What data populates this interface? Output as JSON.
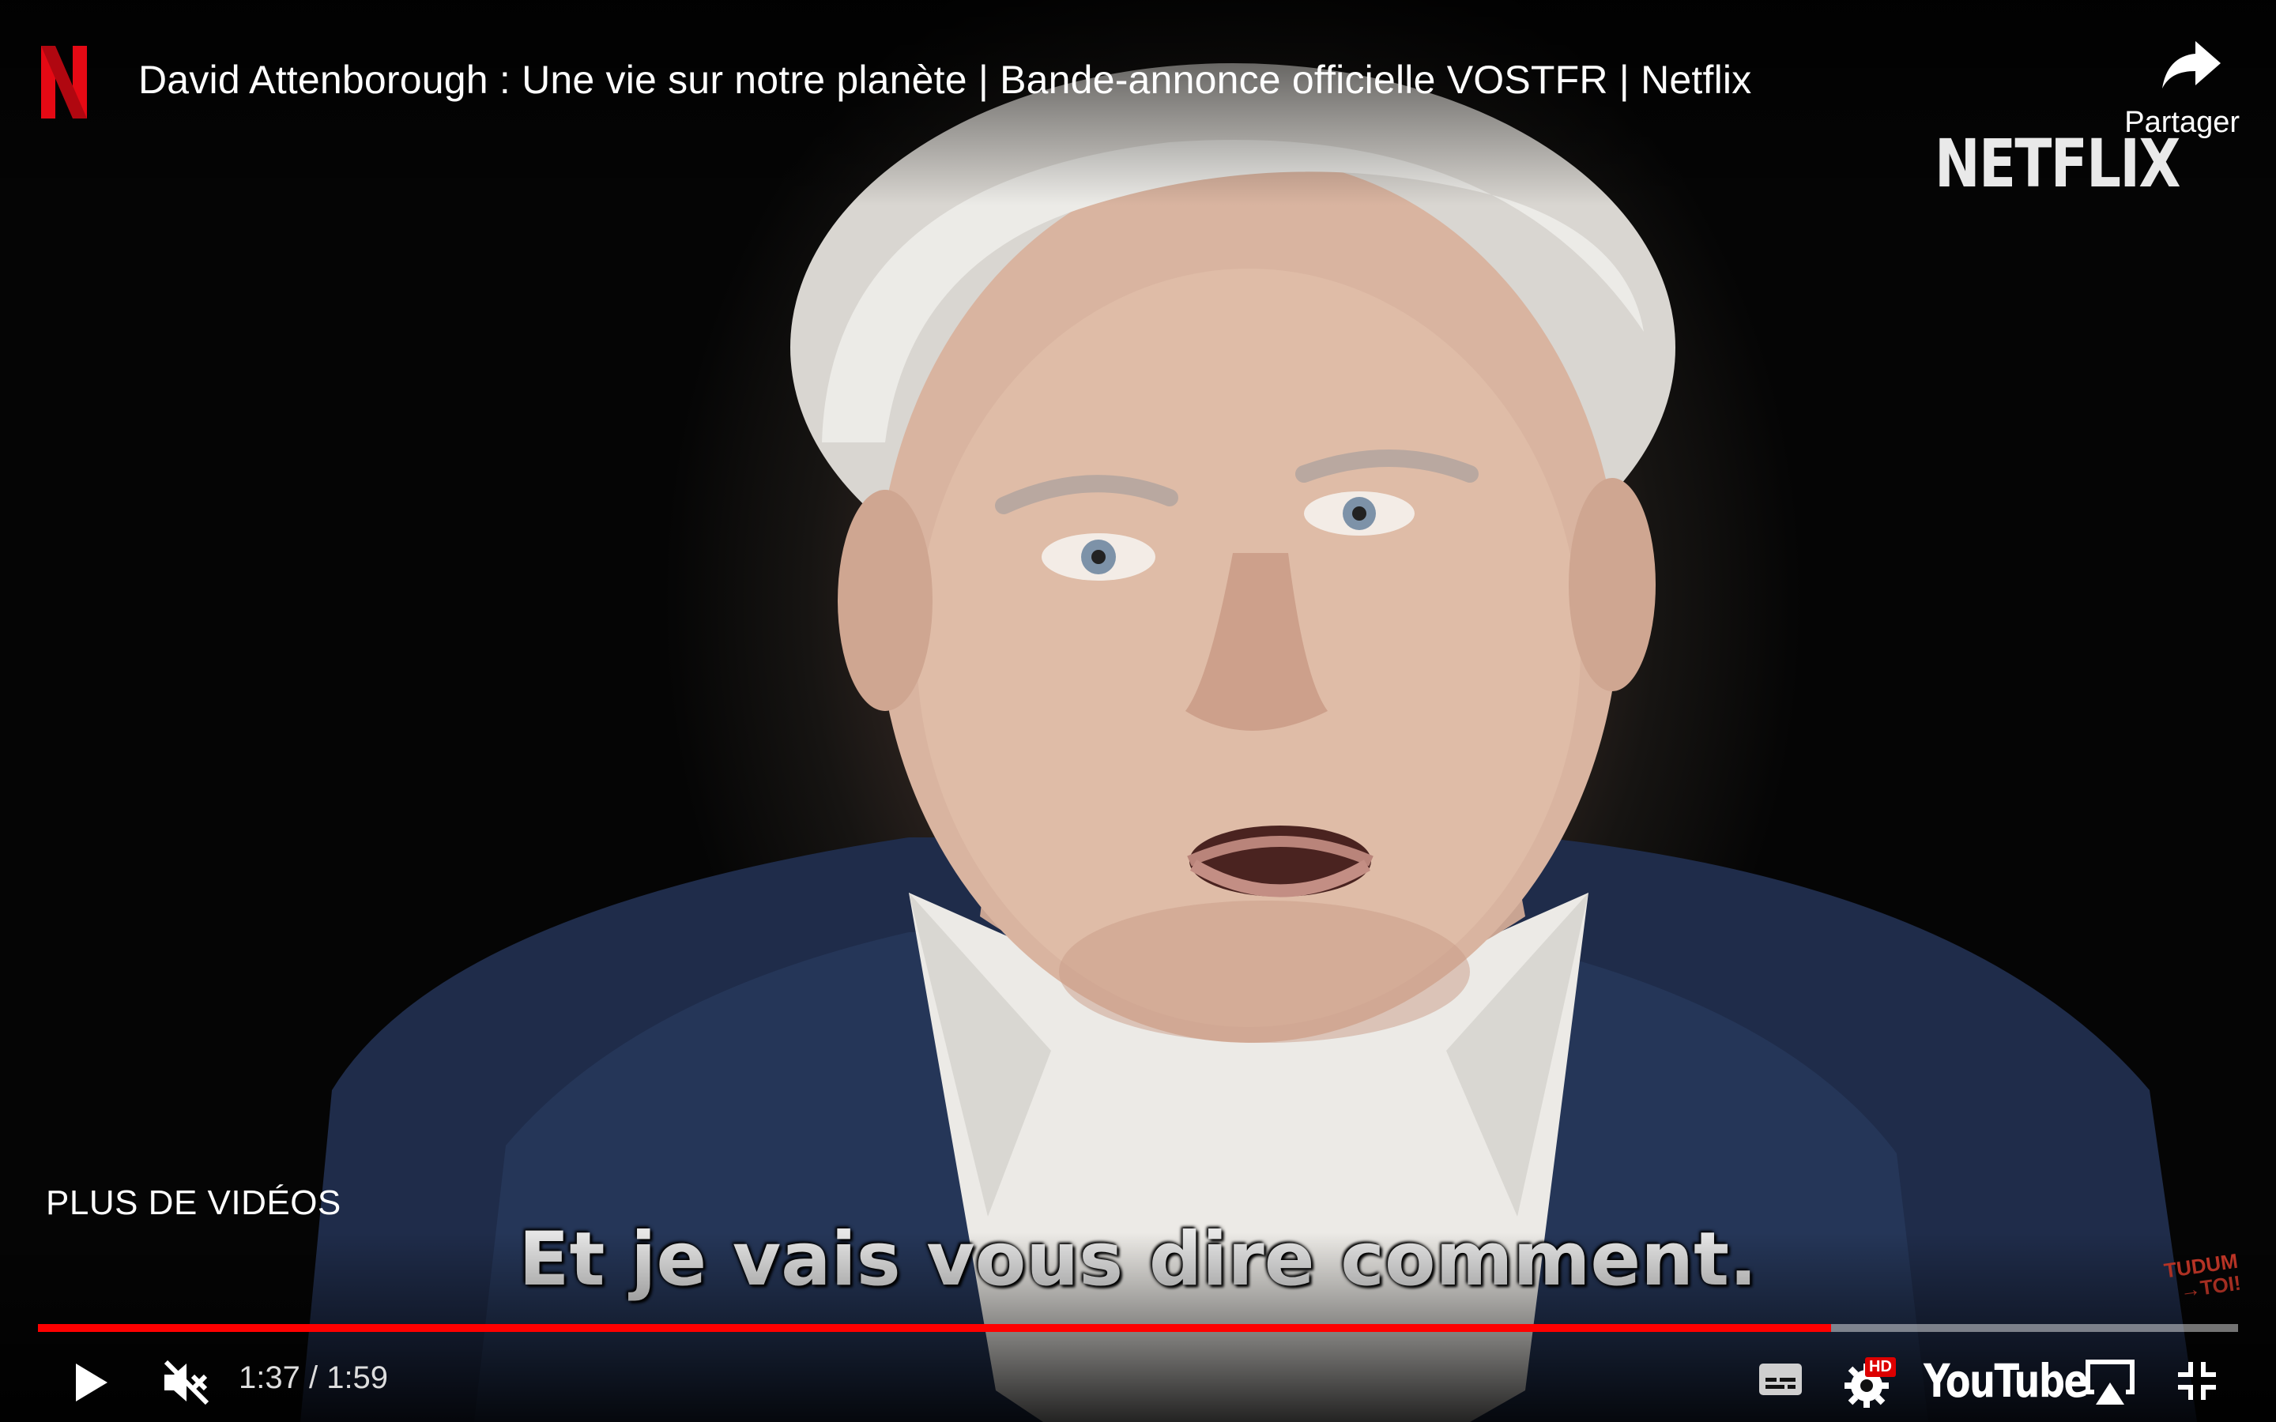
{
  "header": {
    "title": "David Attenborough : Une vie sur notre planète | Bande-annonce officielle VOSTFR | Netflix",
    "share_label": "Partager",
    "brand_watermark": "NETFLIX"
  },
  "overlay": {
    "more_videos": "PLUS DE VIDÉOS",
    "subtitle": "Et je vais vous dire comment.",
    "corner_badge": "TUDUM\n→TOI!"
  },
  "controls": {
    "time": "1:37 / 1:59",
    "progress_fraction": 0.815,
    "youtube_label": "YouTube",
    "hd_badge": "HD"
  },
  "colors": {
    "progress": "#ff0000",
    "netflix_red": "#e50914",
    "subtitle": "#e6e6e6"
  },
  "icons": {
    "channel_logo": "netflix-n-icon",
    "share": "share-arrow-icon",
    "play": "play-icon",
    "mute": "volume-muted-icon",
    "captions": "captions-icon",
    "settings": "settings-gear-icon",
    "airplay": "airplay-icon",
    "fullscreen_exit": "exit-fullscreen-icon"
  }
}
